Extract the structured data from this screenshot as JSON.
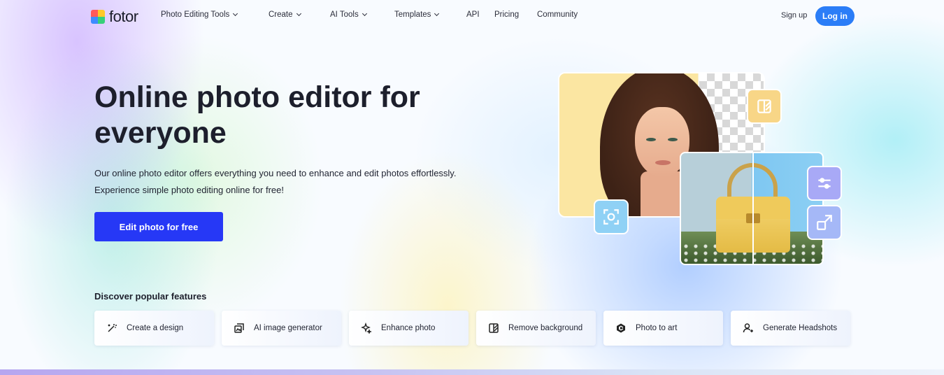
{
  "brand": {
    "name": "fotor"
  },
  "nav": {
    "items": [
      {
        "label": "Photo Editing Tools",
        "dropdown": true
      },
      {
        "label": "Create",
        "dropdown": true
      },
      {
        "label": "AI Tools",
        "dropdown": true
      },
      {
        "label": "Templates",
        "dropdown": true
      },
      {
        "label": "API",
        "dropdown": false
      },
      {
        "label": "Pricing",
        "dropdown": false
      },
      {
        "label": "Community",
        "dropdown": false
      }
    ],
    "signup_label": "Sign up",
    "login_label": "Log in"
  },
  "hero": {
    "title": "Online photo editor for everyone",
    "description": "Our online photo editor offers everything you need to enhance and edit photos effortlessly. Experience simple photo editing online for free!",
    "cta_label": "Edit photo for free"
  },
  "collage": {
    "tools": [
      "split-compare-icon",
      "adjust-sliders-icon",
      "enlarge-icon",
      "focus-icon"
    ]
  },
  "features": {
    "title": "Discover popular features",
    "items": [
      {
        "label": "Create a design",
        "icon": "magic-wand-icon"
      },
      {
        "label": "AI image generator",
        "icon": "ai-image-icon"
      },
      {
        "label": "Enhance photo",
        "icon": "sparkle-enhance-icon"
      },
      {
        "label": "Remove background",
        "icon": "remove-bg-icon"
      },
      {
        "label": "Photo to art",
        "icon": "photo-to-art-icon"
      },
      {
        "label": "Generate Headshots",
        "icon": "headshot-user-icon"
      }
    ]
  },
  "colors": {
    "login_bg": "#2b7df7",
    "cta_bg": "#2638f6",
    "title_text": "#1d1f2c"
  }
}
